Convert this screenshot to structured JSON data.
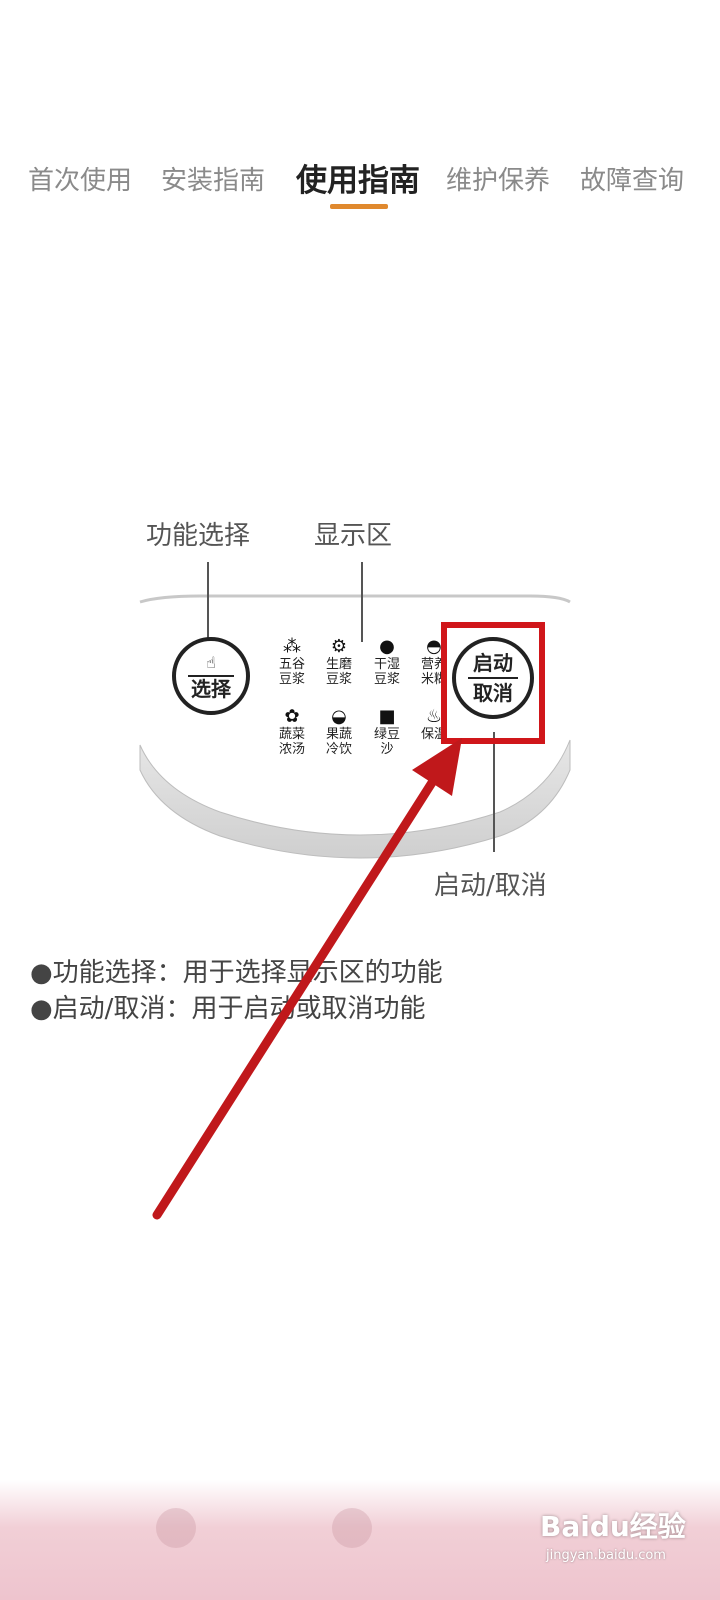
{
  "tabs": [
    {
      "label": "首次使用",
      "active": false
    },
    {
      "label": "安装指南",
      "active": false
    },
    {
      "label": "使用指南",
      "active": true
    },
    {
      "label": "维护保养",
      "active": false
    },
    {
      "label": "故障查询",
      "active": false
    }
  ],
  "accent_color": "#e0892e",
  "highlight_color": "#d0161a",
  "diagram": {
    "callout_function_select": "功能选择",
    "callout_display_area": "显示区",
    "callout_start_cancel": "启动/取消",
    "select_button": {
      "label": "选择"
    },
    "start_button": {
      "line1": "启动",
      "line2": "取消"
    },
    "functions": [
      {
        "icon": "grain-icon",
        "glyph": "⁂",
        "line1": "五谷",
        "line2": "豆浆"
      },
      {
        "icon": "grinder-icon",
        "glyph": "⚙",
        "line1": "生磨",
        "line2": "豆浆"
      },
      {
        "icon": "bean-icon",
        "glyph": "●",
        "line1": "干湿",
        "line2": "豆浆"
      },
      {
        "icon": "bowl-icon",
        "glyph": "◓",
        "line1": "营养",
        "line2": "米糊"
      },
      {
        "icon": "vegetable-icon",
        "glyph": "✿",
        "line1": "蔬菜",
        "line2": "浓汤"
      },
      {
        "icon": "watermelon-icon",
        "glyph": "◒",
        "line1": "果蔬",
        "line2": "冷饮"
      },
      {
        "icon": "mung-bean-icon",
        "glyph": "■",
        "line1": "绿豆",
        "line2": "沙"
      },
      {
        "icon": "warm-cup-icon",
        "glyph": "♨",
        "line1": "保温",
        "line2": ""
      }
    ]
  },
  "notes": [
    "●功能选择：用于选择显示区的功能",
    "●启动/取消：用于启动或取消功能"
  ],
  "watermark": {
    "text": "Baidu经验",
    "sub": "jingyan.baidu.com"
  }
}
